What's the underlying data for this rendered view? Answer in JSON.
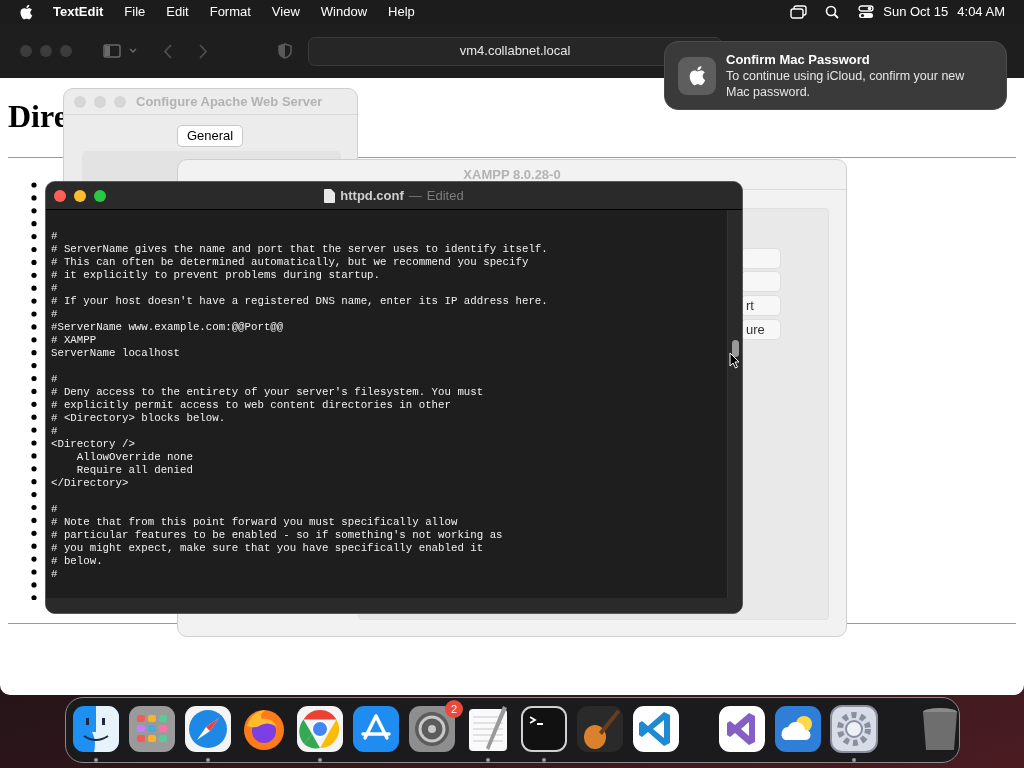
{
  "menu_bar": {
    "app": "TextEdit",
    "items": [
      "File",
      "Edit",
      "Format",
      "View",
      "Window",
      "Help"
    ],
    "date": "Sun Oct 15",
    "time": "4:04 AM"
  },
  "browser": {
    "address": "vm4.collabnet.local",
    "heading": "Dire"
  },
  "apache_window": {
    "title": "Configure Apache Web Server",
    "tab": "General"
  },
  "xampp_window": {
    "title": "XAMPP 8.0.28-0",
    "buttons": [
      "rt",
      "ure"
    ]
  },
  "editor": {
    "title": "httpd.conf",
    "separator": "—",
    "status": "Edited",
    "lines": [
      {
        "kind": "code",
        "text": "#"
      },
      {
        "kind": "code",
        "text": "# ServerName gives the name and port that the server uses to identify itself."
      },
      {
        "kind": "code",
        "text": "# This can often be determined automatically, but we recommend you specify"
      },
      {
        "kind": "code",
        "text": "# it explicitly to prevent problems during startup."
      },
      {
        "kind": "code",
        "text": "#"
      },
      {
        "kind": "code",
        "text": "# If your host doesn't have a registered DNS name, enter its IP address here."
      },
      {
        "kind": "code",
        "text": "#"
      },
      {
        "kind": "code",
        "text": "#ServerName www.example.com:@@Port@@"
      },
      {
        "kind": "code",
        "text": "# XAMPP"
      },
      {
        "kind": "code",
        "text": "ServerName localhost"
      },
      {
        "kind": "blank"
      },
      {
        "kind": "code",
        "text": "#"
      },
      {
        "kind": "code",
        "text": "# Deny access to the entirety of your server's filesystem. You must"
      },
      {
        "kind": "code",
        "text": "# explicitly permit access to web content directories in other"
      },
      {
        "kind": "code",
        "text": "# <Directory> blocks below."
      },
      {
        "kind": "code",
        "text": "#"
      },
      {
        "kind": "code",
        "text": "<Directory />"
      },
      {
        "kind": "code",
        "text": "    AllowOverride none"
      },
      {
        "kind": "code",
        "text": "    Require all denied"
      },
      {
        "kind": "code",
        "text": "</Directory>"
      },
      {
        "kind": "blank"
      },
      {
        "kind": "code",
        "text": "#"
      },
      {
        "kind": "code",
        "text": "# Note that from this point forward you must specifically allow"
      },
      {
        "kind": "code",
        "text": "# particular features to be enabled - so if something's not working as"
      },
      {
        "kind": "code",
        "text": "# you might expect, make sure that you have specifically enabled it"
      },
      {
        "kind": "code",
        "text": "# below."
      },
      {
        "kind": "code",
        "text": "#"
      }
    ]
  },
  "notification": {
    "title": "Confirm Mac Password",
    "message": "To continue using iCloud, confirm your new Mac password."
  },
  "dock": {
    "items": [
      {
        "kind": "finder",
        "running": true
      },
      {
        "kind": "launchpad",
        "running": false
      },
      {
        "kind": "safari",
        "running": true
      },
      {
        "kind": "firefox",
        "running": false
      },
      {
        "kind": "chrome",
        "running": true
      },
      {
        "kind": "appstore",
        "running": false
      },
      {
        "kind": "settings",
        "running": false,
        "badge": "2"
      },
      {
        "kind": "textedit",
        "running": true
      },
      {
        "kind": "terminal",
        "running": true
      },
      {
        "kind": "guitar",
        "running": false
      },
      {
        "kind": "vscode",
        "running": false
      },
      {
        "kind": "separator"
      },
      {
        "kind": "visualstudio",
        "running": false
      },
      {
        "kind": "weather",
        "running": false
      },
      {
        "kind": "gear",
        "running": true
      },
      {
        "kind": "separator"
      },
      {
        "kind": "trash",
        "running": false
      }
    ]
  }
}
